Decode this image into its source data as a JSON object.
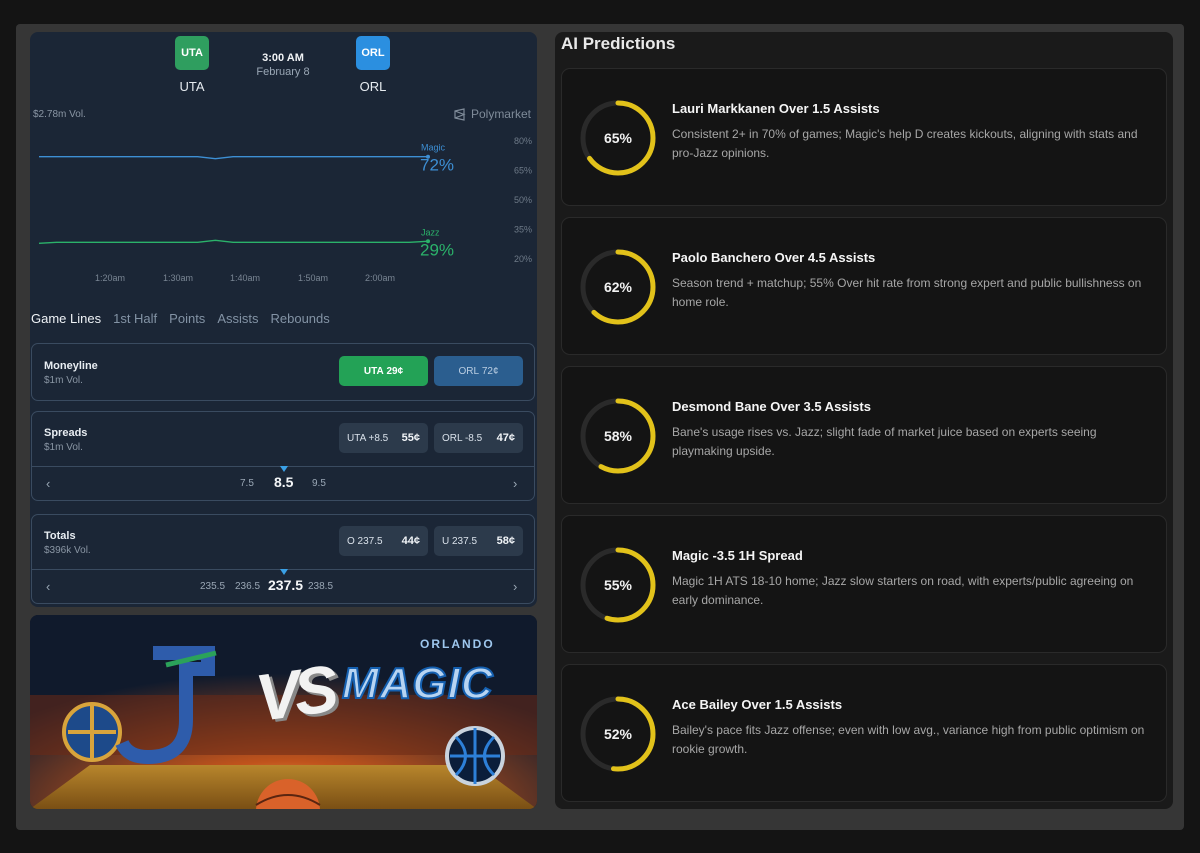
{
  "game": {
    "team_a": {
      "abbr": "UTA",
      "name": "UTA",
      "color": "#2f9e5f"
    },
    "team_b": {
      "abbr": "ORL",
      "name": "ORL",
      "color": "#2b8fe0"
    },
    "time": "3:00 AM",
    "date": "February 8",
    "volume": "$2.78m Vol.",
    "source": "Polymarket"
  },
  "chart_data": {
    "type": "line",
    "x": [
      "1:20am",
      "1:30am",
      "1:40am",
      "1:50am",
      "2:00am"
    ],
    "y_ticks": [
      "80%",
      "65%",
      "50%",
      "35%",
      "20%"
    ],
    "ylim": [
      20,
      80
    ],
    "series": [
      {
        "name": "Magic",
        "color": "#3d8fd4",
        "latest": "72%",
        "values": [
          72,
          72,
          72,
          72,
          72,
          72,
          72,
          72,
          72,
          72,
          71,
          72,
          72,
          72,
          72,
          72,
          72,
          72,
          72,
          72,
          72,
          72,
          72
        ]
      },
      {
        "name": "Jazz",
        "color": "#2bb26a",
        "latest": "29%",
        "values": [
          28,
          28.5,
          28.5,
          28.5,
          28.5,
          28.5,
          28.5,
          28.5,
          28.5,
          28.5,
          29.5,
          28.5,
          28.5,
          28.5,
          28.5,
          28.5,
          28.5,
          28.5,
          28.5,
          28.5,
          28.5,
          28.5,
          29
        ]
      }
    ],
    "grid": false
  },
  "tabs": [
    "Game Lines",
    "1st Half",
    "Points",
    "Assists",
    "Rebounds"
  ],
  "moneyline": {
    "title": "Moneyline",
    "vol": "$1m Vol.",
    "uta_label": "UTA",
    "uta_price": "29¢",
    "orl_label": "ORL",
    "orl_price": "72¢"
  },
  "spreads": {
    "title": "Spreads",
    "vol": "$1m Vol.",
    "a_label": "UTA +8.5",
    "a_price": "55¢",
    "b_label": "ORL -8.5",
    "b_price": "47¢",
    "values": [
      "7.5",
      "8.5",
      "9.5"
    ]
  },
  "totals": {
    "title": "Totals",
    "vol": "$396k Vol.",
    "a_label": "O 237.5",
    "a_price": "44¢",
    "b_label": "U 237.5",
    "b_price": "58¢",
    "values": [
      "235.5",
      "236.5",
      "237.5",
      "238.5"
    ]
  },
  "banner": {
    "orlando": "ORLANDO",
    "magic": "MAGIC",
    "vs": "VS"
  },
  "ai": {
    "title": "AI Predictions",
    "ring_color": "#e2c21a",
    "items": [
      {
        "pct": "65%",
        "value": 65,
        "title": "Lauri Markkanen Over 1.5 Assists",
        "text": "Consistent 2+ in 70% of games; Magic's help D creates kickouts, aligning with stats and pro-Jazz opinions."
      },
      {
        "pct": "62%",
        "value": 62,
        "title": "Paolo Banchero Over 4.5 Assists",
        "text": "Season trend + matchup; 55% Over hit rate from strong expert and public bullishness on home role."
      },
      {
        "pct": "58%",
        "value": 58,
        "title": "Desmond Bane Over 3.5 Assists",
        "text": "Bane's usage rises vs. Jazz; slight fade of market juice based on experts seeing playmaking upside."
      },
      {
        "pct": "55%",
        "value": 55,
        "title": "Magic -3.5 1H Spread",
        "text": "Magic 1H ATS 18-10 home; Jazz slow starters on road, with experts/public agreeing on early dominance."
      },
      {
        "pct": "52%",
        "value": 52,
        "title": "Ace Bailey Over 1.5 Assists",
        "text": "Bailey's pace fits Jazz offense; even with low avg., variance high from public optimism on rookie growth."
      }
    ]
  }
}
